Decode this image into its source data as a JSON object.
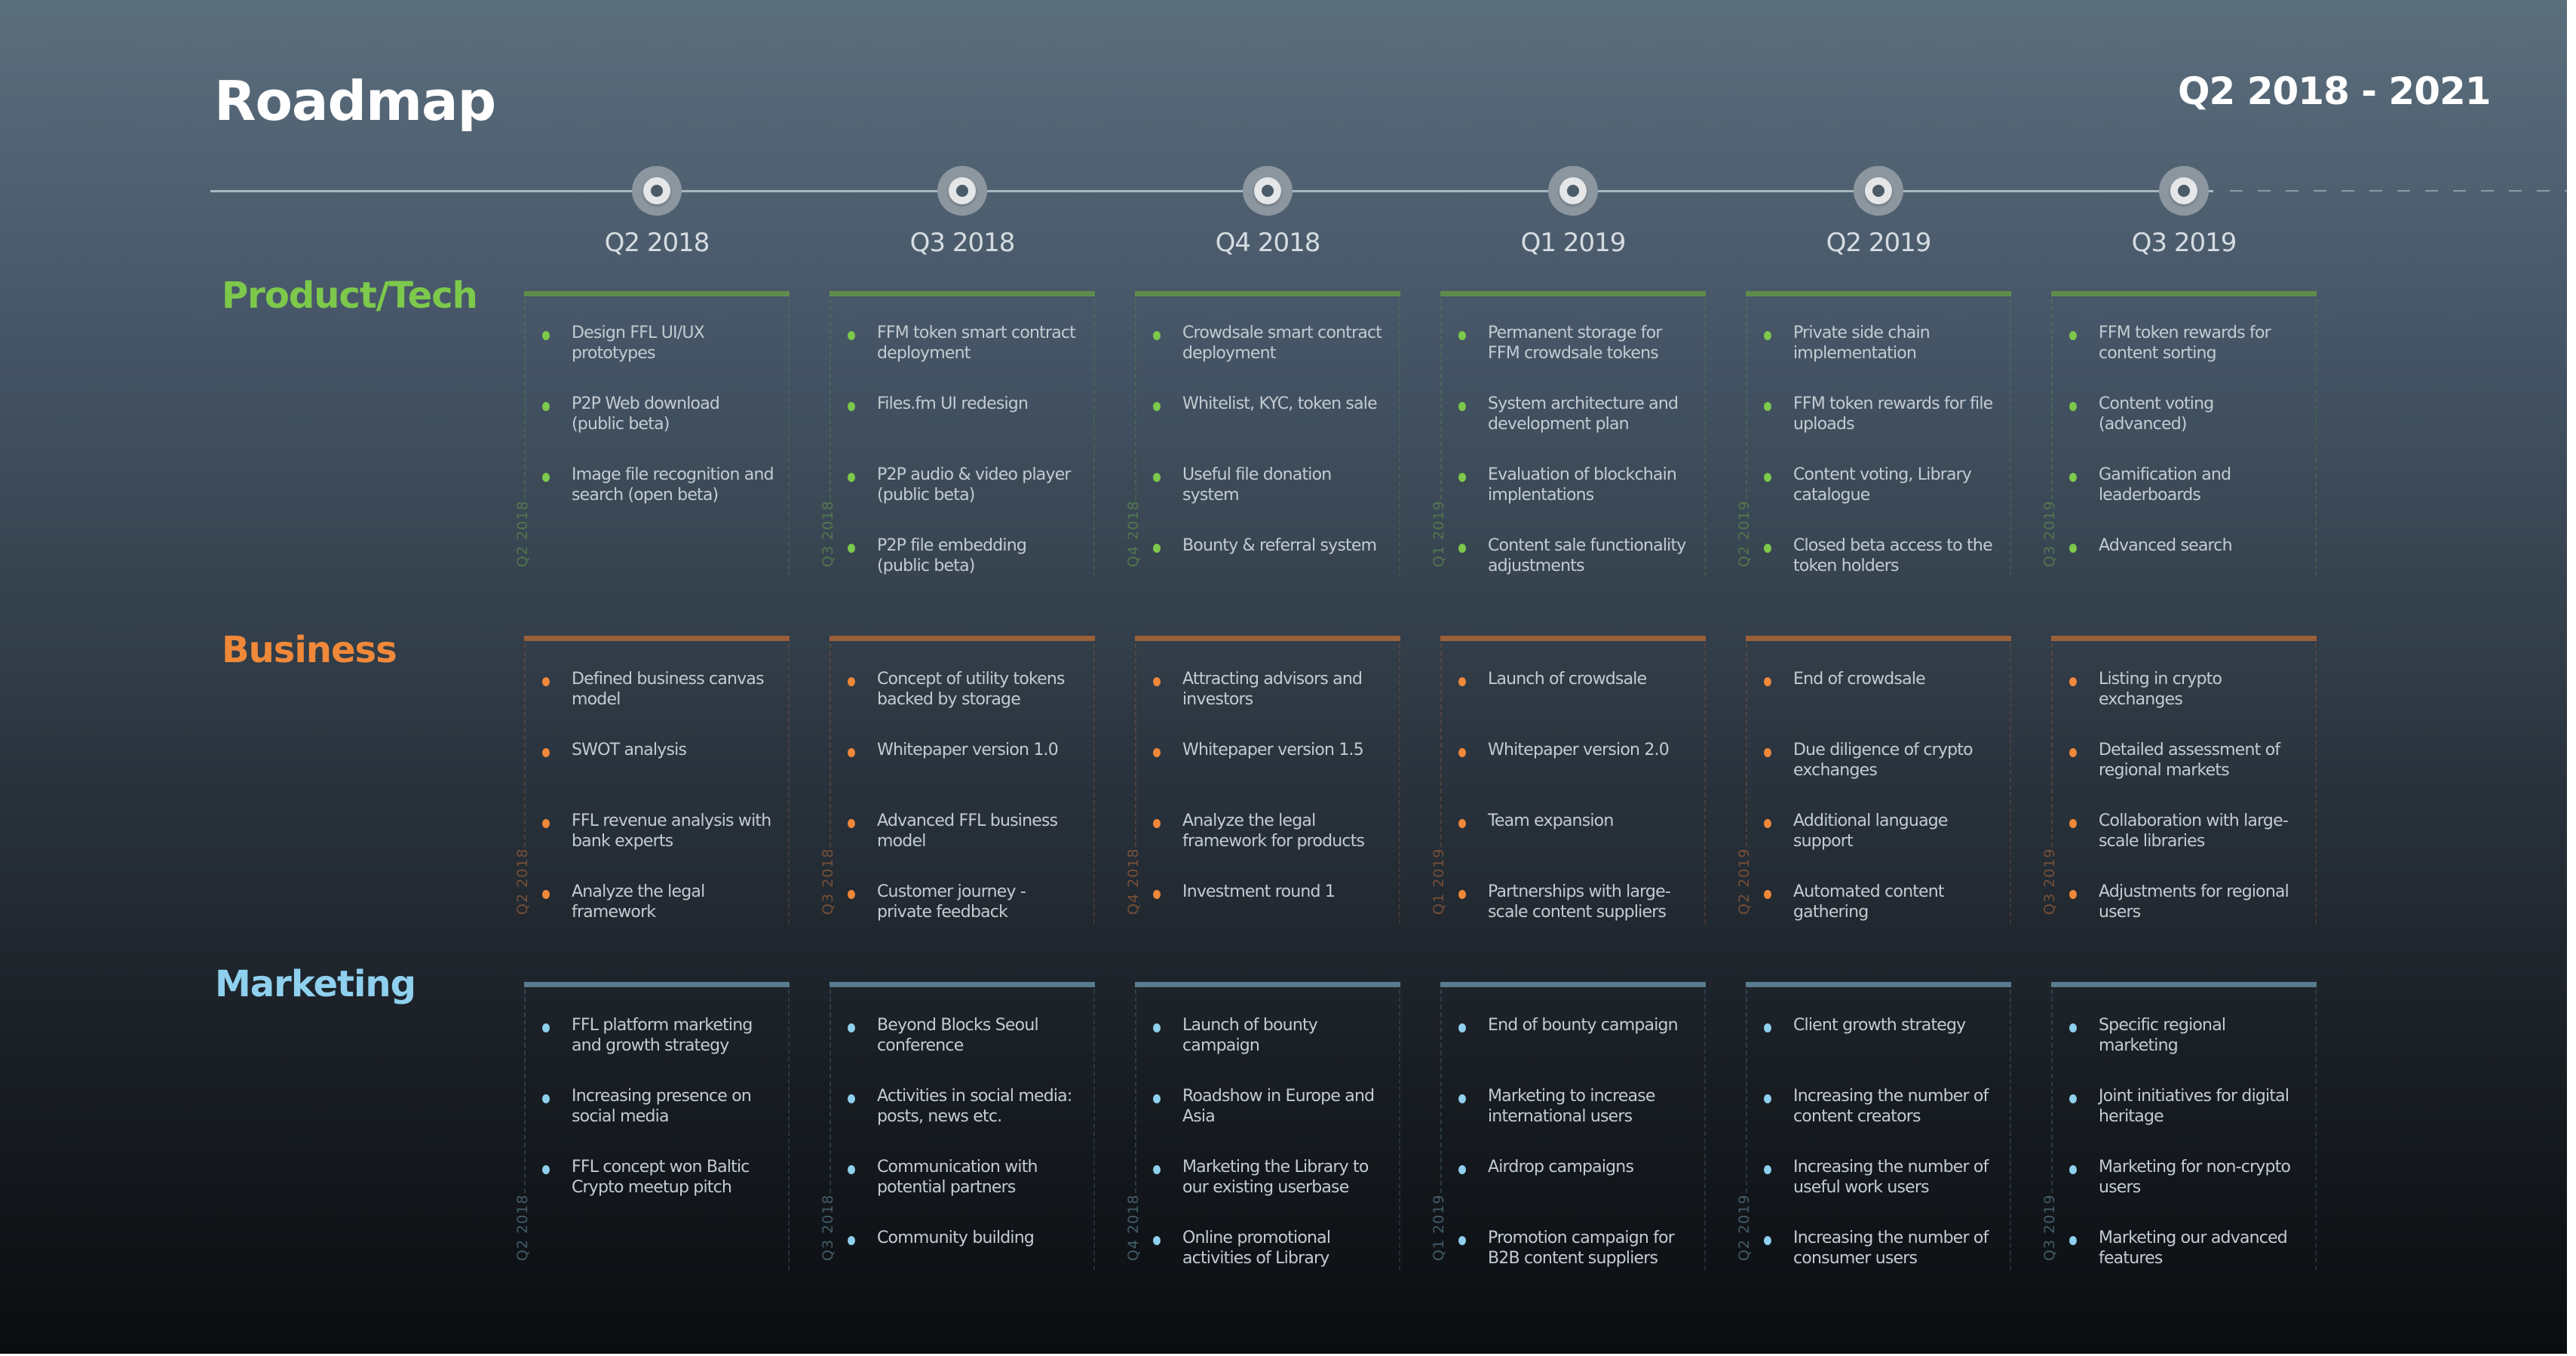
{
  "header": {
    "title": "Roadmap",
    "range": "Q2 2018 - 2021"
  },
  "quarters": [
    "Q2 2018",
    "Q3 2018",
    "Q4 2018",
    "Q1 2019",
    "Q2 2019",
    "Q3 2019"
  ],
  "colors": {
    "product": "#7dc94b",
    "product_bar": "#5e8c4b",
    "business": "#f0883a",
    "business_bar": "#9b5f3a",
    "marketing": "#8fd0ee",
    "marketing_bar": "#587b8d"
  },
  "sections": [
    {
      "key": "product",
      "label": "Product/Tech",
      "columns": [
        {
          "quarter": "Q2 2018",
          "items": [
            "Design FFL UI/UX prototypes",
            "P2P Web download (public beta)",
            "Image file recognition and search (open beta)"
          ]
        },
        {
          "quarter": "Q3 2018",
          "items": [
            "FFM token smart contract deployment",
            "Files.fm UI redesign",
            "P2P audio & video player (public beta)",
            "P2P file embedding (public beta)"
          ]
        },
        {
          "quarter": "Q4 2018",
          "items": [
            "Crowdsale smart contract deployment",
            "Whitelist, KYC, token sale",
            "Useful file donation system",
            "Bounty & referral system"
          ]
        },
        {
          "quarter": "Q1 2019",
          "items": [
            "Permanent storage for FFM crowdsale tokens",
            "System architecture and development plan",
            "Evaluation of blockchain implentations",
            "Content sale functionality adjustments"
          ]
        },
        {
          "quarter": "Q2 2019",
          "items": [
            "Private side chain implementation",
            "FFM token rewards for file uploads",
            "Content voting, Library catalogue",
            "Closed beta access to the token holders"
          ]
        },
        {
          "quarter": "Q3 2019",
          "items": [
            "FFM token rewards for content sorting",
            "Content voting (advanced)",
            "Gamification and leaderboards",
            "Advanced search"
          ]
        }
      ]
    },
    {
      "key": "business",
      "label": "Business",
      "columns": [
        {
          "quarter": "Q2 2018",
          "items": [
            "Defined business canvas model",
            "SWOT analysis",
            "FFL revenue analysis with bank experts",
            "Analyze the legal framework"
          ]
        },
        {
          "quarter": "Q3 2018",
          "items": [
            "Concept of utility tokens backed by storage",
            "Whitepaper version 1.0",
            "Advanced FFL business model",
            "Customer journey - private feedback"
          ]
        },
        {
          "quarter": "Q4 2018",
          "items": [
            "Attracting advisors and investors",
            "Whitepaper version 1.5",
            "Analyze the legal framework for products",
            "Investment round 1"
          ]
        },
        {
          "quarter": "Q1 2019",
          "items": [
            "Launch of crowdsale",
            "Whitepaper version 2.0",
            "Team expansion",
            "Partnerships with large-scale content suppliers"
          ]
        },
        {
          "quarter": "Q2 2019",
          "items": [
            "End of crowdsale",
            "Due diligence of crypto exchanges",
            "Additional language support",
            "Automated content gathering"
          ]
        },
        {
          "quarter": "Q3 2019",
          "items": [
            "Listing in crypto exchanges",
            "Detailed assessment of regional markets",
            "Collaboration with large-scale libraries",
            "Adjustments for regional users"
          ]
        }
      ]
    },
    {
      "key": "marketing",
      "label": "Marketing",
      "columns": [
        {
          "quarter": "Q2 2018",
          "items": [
            "FFL platform marketing and growth strategy",
            "Increasing presence on social media",
            "FFL concept won Baltic Crypto meetup pitch"
          ]
        },
        {
          "quarter": "Q3 2018",
          "items": [
            "Beyond Blocks Seoul conference",
            "Activities in social media: posts, news etc.",
            "Communication with potential partners",
            "Community building"
          ]
        },
        {
          "quarter": "Q4 2018",
          "items": [
            "Launch of bounty campaign",
            "Roadshow in Europe and Asia",
            "Marketing the Library to our existing userbase",
            "Online promotional activities of Library"
          ]
        },
        {
          "quarter": "Q1 2019",
          "items": [
            "End of bounty campaign",
            "Marketing to increase international users",
            "Airdrop campaigns",
            "Promotion campaign for B2B content suppliers"
          ]
        },
        {
          "quarter": "Q2 2019",
          "items": [
            "Client growth strategy",
            "Increasing the number of content creators",
            "Increasing the number of useful work users",
            "Increasing the number of consumer users"
          ]
        },
        {
          "quarter": "Q3 2019",
          "items": [
            "Specific regional marketing",
            "Joint initiatives for digital heritage",
            "Marketing for non-crypto users",
            "Marketing our advanced features"
          ]
        }
      ]
    }
  ]
}
